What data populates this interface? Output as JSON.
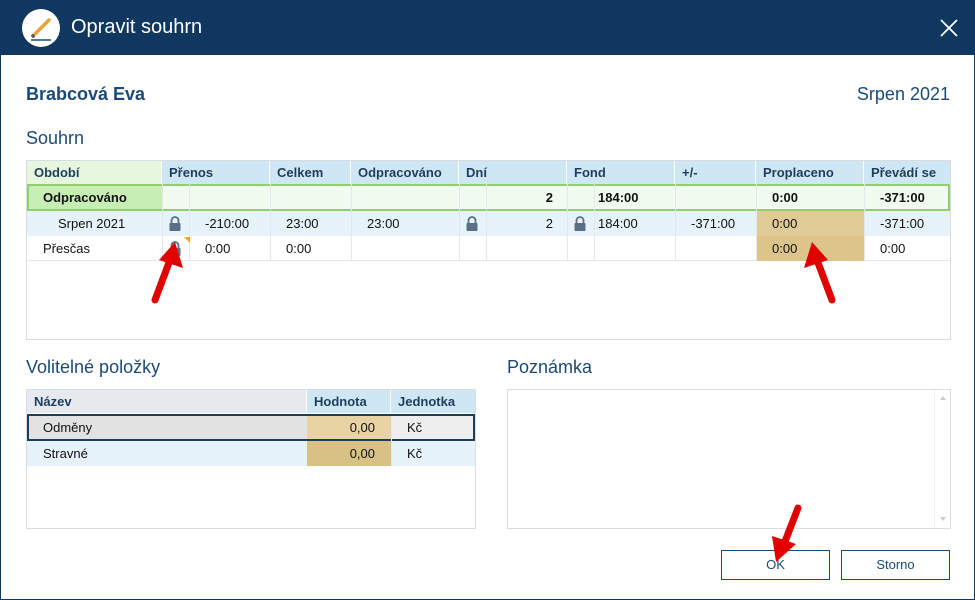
{
  "window": {
    "title": "Opravit souhrn",
    "close_icon": "close-icon"
  },
  "header": {
    "employee": "Brabcová Eva",
    "period": "Srpen 2021"
  },
  "summary": {
    "title": "Souhrn",
    "columns": [
      "Období",
      "Přenos",
      "Celkem",
      "Odpracováno",
      "Dní",
      "Fond",
      "+/-",
      "Proplaceno",
      "Převádí se"
    ],
    "rows": [
      {
        "obdobi": "Odpracováno",
        "prenos": "",
        "celkem": "",
        "odpracovano": "",
        "dni": "2",
        "fond": "184:00",
        "plusminus": "",
        "proplaceno": "0:00",
        "prevadi": "-371:00"
      },
      {
        "obdobi": "Srpen 2021",
        "prenos": "-210:00",
        "celkem": "23:00",
        "odpracovano": "23:00",
        "dni": "2",
        "fond": "184:00",
        "plusminus": "-371:00",
        "proplaceno": "0:00",
        "prevadi": "-371:00"
      },
      {
        "obdobi": "Přesčas",
        "prenos": "0:00",
        "celkem": "0:00",
        "odpracovano": "",
        "dni": "",
        "fond": "",
        "plusminus": "",
        "proplaceno": "0:00",
        "prevadi": "0:00"
      }
    ]
  },
  "optional": {
    "title": "Volitelné položky",
    "columns": [
      "Název",
      "Hodnota",
      "Jednotka"
    ],
    "rows": [
      {
        "nazev": "Odměny",
        "hodnota": "0,00",
        "jednotka": "Kč"
      },
      {
        "nazev": "Stravné",
        "hodnota": "0,00",
        "jednotka": "Kč"
      }
    ]
  },
  "note": {
    "title": "Poznámka",
    "value": ""
  },
  "buttons": {
    "ok": "OK",
    "cancel": "Storno"
  },
  "colors": {
    "titlebar": "#0f3760",
    "accent": "#1c4a78",
    "header_bg": "#cfe6f4",
    "paid_cell": "#dcc48a",
    "arrow": "#e00000"
  }
}
